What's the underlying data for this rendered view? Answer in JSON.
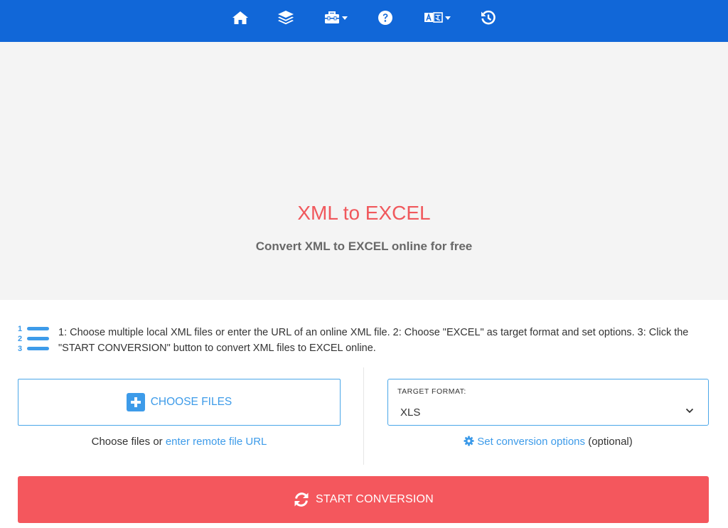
{
  "nav": {
    "items": [
      {
        "icon": "home-icon"
      },
      {
        "icon": "layers-icon"
      },
      {
        "icon": "toolbox-icon",
        "has_dropdown": true
      },
      {
        "icon": "help-icon"
      },
      {
        "icon": "language-icon",
        "has_dropdown": true
      },
      {
        "icon": "history-icon"
      }
    ]
  },
  "hero": {
    "title": "XML to EXCEL",
    "subtitle": "Convert XML to EXCEL online for free"
  },
  "instructions": {
    "text": "1: Choose multiple local XML files or enter the URL of an online XML file. 2: Choose \"EXCEL\" as target format and set options. 3: Click the \"START CONVERSION\" button to convert XML files to EXCEL online."
  },
  "upload": {
    "choose_label": "CHOOSE FILES",
    "hint_prefix": "Choose files or ",
    "hint_link": "enter remote file URL"
  },
  "target": {
    "label": "TARGET FORMAT:",
    "value": "XLS",
    "options_link": "Set conversion options",
    "options_suffix": " (optional)"
  },
  "start": {
    "label": "START CONVERSION"
  },
  "colors": {
    "nav_bg": "#1167d8",
    "accent_blue": "#3d9be9",
    "title_red": "#f0585c",
    "start_red": "#f4575d"
  }
}
